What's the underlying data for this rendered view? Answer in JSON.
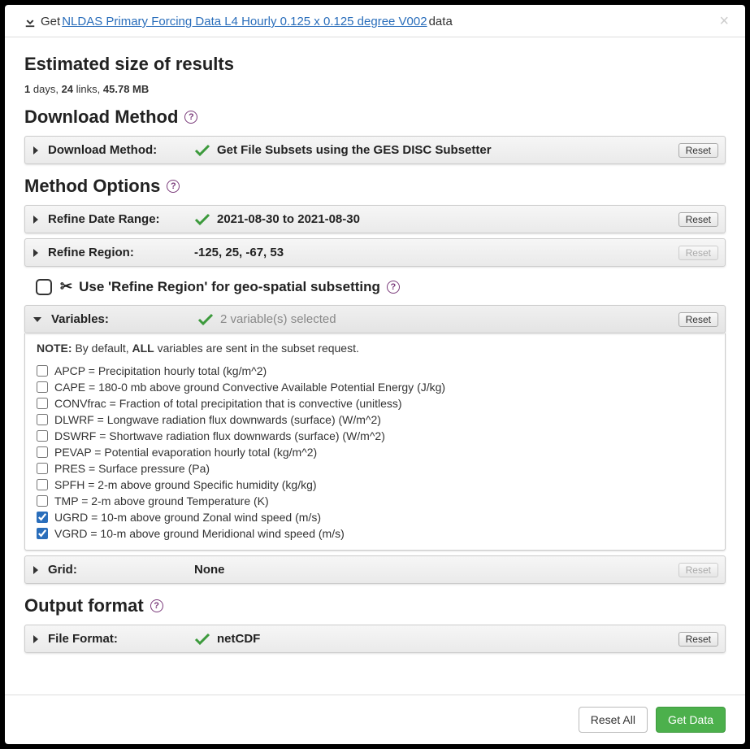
{
  "header": {
    "get": "Get",
    "link": "NLDAS Primary Forcing Data L4 Hourly 0.125 x 0.125 degree V002",
    "suffix": "data"
  },
  "estimated": {
    "title": "Estimated size of results",
    "days": "1",
    "days_label": "days,",
    "links": "24",
    "links_label": "links,",
    "size": "45.78 MB"
  },
  "download_method": {
    "section_title": "Download Method",
    "row_label": "Download Method:",
    "value": "Get File Subsets using the GES DISC Subsetter",
    "reset": "Reset"
  },
  "method_options": {
    "section_title": "Method Options",
    "date": {
      "label": "Refine Date Range:",
      "value": "2021-08-30 to 2021-08-30",
      "reset": "Reset"
    },
    "region": {
      "label": "Refine Region:",
      "value": "-125, 25, -67, 53",
      "reset": "Reset"
    },
    "geo_label": "Use 'Refine Region' for geo-spatial subsetting",
    "variables": {
      "label": "Variables:",
      "summary": "2 variable(s) selected",
      "reset": "Reset",
      "note_prefix": "NOTE:",
      "note_mid": "By default,",
      "note_all": "ALL",
      "note_suffix": "variables are sent in the subset request.",
      "items": [
        {
          "checked": false,
          "label": "APCP = Precipitation hourly total (kg/m^2)"
        },
        {
          "checked": false,
          "label": "CAPE = 180-0 mb above ground Convective Available Potential Energy (J/kg)"
        },
        {
          "checked": false,
          "label": "CONVfrac = Fraction of total precipitation that is convective (unitless)"
        },
        {
          "checked": false,
          "label": "DLWRF = Longwave radiation flux downwards (surface) (W/m^2)"
        },
        {
          "checked": false,
          "label": "DSWRF = Shortwave radiation flux downwards (surface) (W/m^2)"
        },
        {
          "checked": false,
          "label": "PEVAP = Potential evaporation hourly total (kg/m^2)"
        },
        {
          "checked": false,
          "label": "PRES = Surface pressure (Pa)"
        },
        {
          "checked": false,
          "label": "SPFH = 2-m above ground Specific humidity (kg/kg)"
        },
        {
          "checked": false,
          "label": "TMP = 2-m above ground Temperature (K)"
        },
        {
          "checked": true,
          "label": "UGRD = 10-m above ground Zonal wind speed (m/s)"
        },
        {
          "checked": true,
          "label": "VGRD = 10-m above ground Meridional wind speed (m/s)"
        }
      ]
    },
    "grid": {
      "label": "Grid:",
      "value": "None",
      "reset": "Reset"
    }
  },
  "output_format": {
    "section_title": "Output format",
    "label": "File Format:",
    "value": "netCDF",
    "reset": "Reset"
  },
  "footer": {
    "reset_all": "Reset All",
    "get_data": "Get Data"
  }
}
